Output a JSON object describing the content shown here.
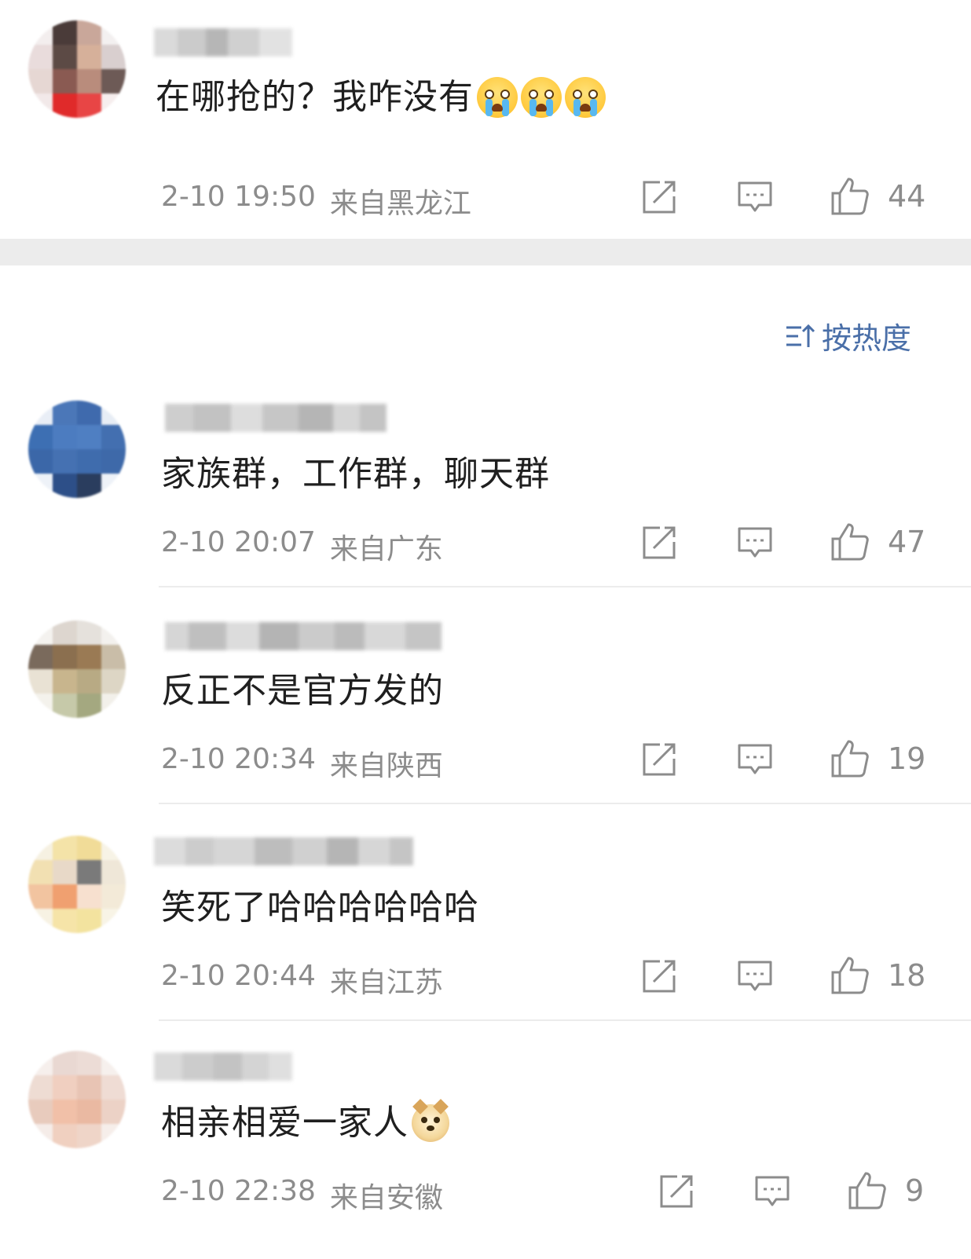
{
  "top_comment": {
    "text": "在哪抢的？我咋没有",
    "emoji_count": 3,
    "emoji_name": "crying-face",
    "time": "2-10 19:50",
    "location": "来自黑龙江",
    "likes": "44"
  },
  "sort": {
    "label": "按热度",
    "icon": "sort-icon"
  },
  "comments": [
    {
      "text": "家族群，工作群，聊天群",
      "time": "2-10 20:07",
      "location": "来自广东",
      "likes": "47"
    },
    {
      "text": "反正不是官方发的",
      "time": "2-10 20:34",
      "location": "来自陕西",
      "likes": "19"
    },
    {
      "text": "笑死了哈哈哈哈哈哈",
      "time": "2-10 20:44",
      "location": "来自江苏",
      "likes": "18"
    },
    {
      "text": "相亲相爱一家人",
      "emoji_name": "doge",
      "time": "2-10 22:38",
      "location": "来自安徽",
      "likes": "9"
    }
  ],
  "colors": {
    "text_primary": "#1f1f1f",
    "text_secondary": "#8c8c8c",
    "accent": "#4a6fa8",
    "divider": "#ececec"
  }
}
